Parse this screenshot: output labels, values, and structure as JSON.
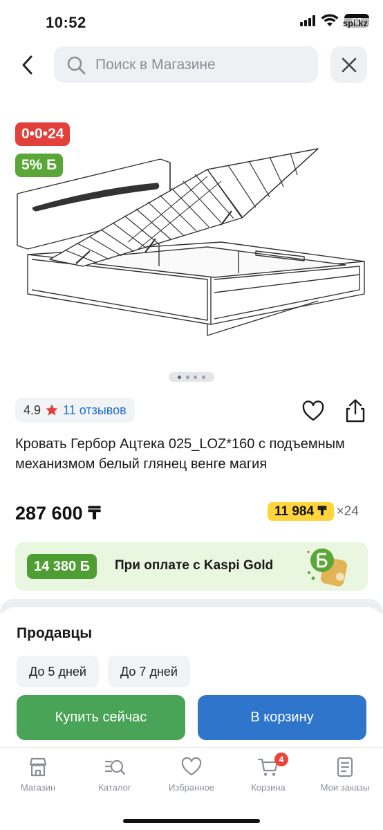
{
  "status_bar": {
    "time": "10:52",
    "battery": "67",
    "overlay_text": "spi.kz"
  },
  "header": {
    "search_placeholder": "Поиск в Магазине"
  },
  "product": {
    "promo_badge": "0•0•24",
    "bonus_badge": "5% Б",
    "gallery": {
      "count": 4,
      "active_index": 0
    },
    "rating": "4.9",
    "reviews": "11 отзывов",
    "title": "Кровать Гербор Ацтека 025_LOZ*160 с подъемным механизмом белый глянец венге магия",
    "price": "287 600 ₸",
    "installment_amount": "11 984 ₸",
    "installment_months": "×24"
  },
  "gold_banner": {
    "bonus": "14 380 Б",
    "text": "При оплате с Kaspi Gold"
  },
  "sellers": {
    "title": "Продавцы",
    "filters": [
      "До 5 дней",
      "До 7 дней"
    ]
  },
  "actions": {
    "buy_now": "Купить сейчас",
    "add_to_cart": "В корзину"
  },
  "tab_bar": {
    "items": [
      {
        "label": "Магазин",
        "icon": "store-icon"
      },
      {
        "label": "Каталог",
        "icon": "catalog-icon"
      },
      {
        "label": "Избранное",
        "icon": "heart-icon"
      },
      {
        "label": "Корзина",
        "icon": "cart-icon",
        "badge": "4"
      },
      {
        "label": "Мои заказы",
        "icon": "orders-icon"
      }
    ]
  },
  "colors": {
    "promo_red": "#e2403b",
    "bonus_green": "#5aa636",
    "buy_green": "#4aa457",
    "cart_blue": "#2f75cc",
    "installment_yellow": "#ffd53b",
    "link_blue": "#1a6fd1"
  }
}
